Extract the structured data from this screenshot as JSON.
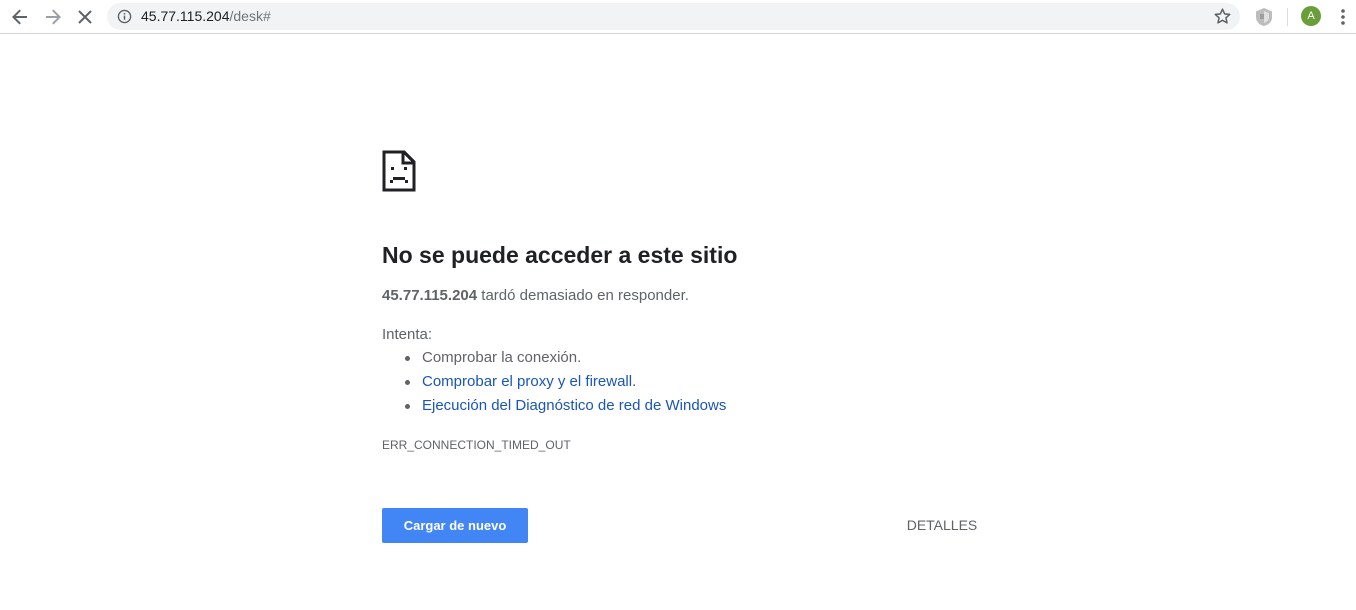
{
  "toolbar": {
    "url_host": "45.77.115.204",
    "url_path": "/desk#",
    "avatar_initial": "A",
    "avatar_color": "#6a9e3a",
    "icons": {
      "back": "arrow-left-icon",
      "forward": "arrow-right-icon",
      "stop": "close-icon",
      "site_info": "info-icon",
      "bookmark": "star-icon",
      "extension": "extension-icon",
      "menu": "kebab-menu-icon"
    }
  },
  "error": {
    "title": "No se puede acceder a este sitio",
    "host": "45.77.115.204",
    "message": " tardó demasiado en responder.",
    "try_label": "Intenta:",
    "suggestions": [
      {
        "text": "Comprobar la conexión.",
        "is_link": false
      },
      {
        "text": "Comprobar el proxy y el firewall.",
        "is_link": true
      },
      {
        "text": "Ejecución del Diagnóstico de red de Windows",
        "is_link": true
      }
    ],
    "code": "ERR_CONNECTION_TIMED_OUT",
    "reload_label": "Cargar de nuevo",
    "details_label": "DETALLES",
    "icon": "sad-document-icon"
  },
  "colors": {
    "primary_button": "#4285f4",
    "link": "#1a55b8",
    "secondary_text": "#5f6368"
  }
}
